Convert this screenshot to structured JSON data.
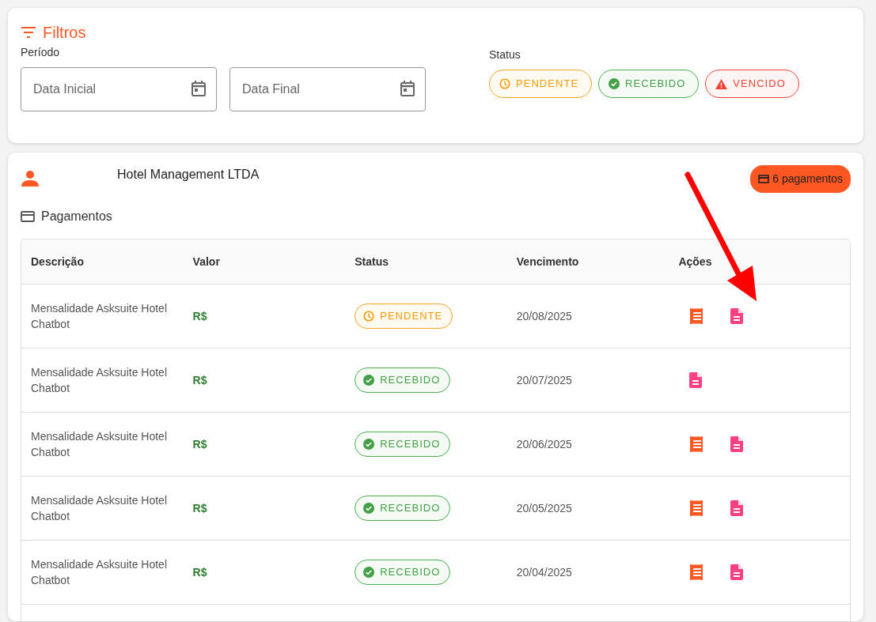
{
  "filters": {
    "title": "Filtros",
    "period_label": "Período",
    "date_fields": [
      {
        "placeholder": "Data Inicial"
      },
      {
        "placeholder": "Data Final"
      }
    ],
    "status_label": "Status",
    "status_chips": [
      {
        "kind": "pendente",
        "label": "PENDENTE"
      },
      {
        "kind": "recebido",
        "label": "RECEBIDO"
      },
      {
        "kind": "vencido",
        "label": "VENCIDO"
      }
    ]
  },
  "client": {
    "name": "Hotel Management LTDA",
    "payments_badge": "6 pagamentos",
    "section_title": "Pagamentos",
    "table": {
      "columns": [
        "Descrição",
        "Valor",
        "Status",
        "Vencimento",
        "Ações"
      ],
      "rows": [
        {
          "description": "Mensalidade Asksuite Hotel Chatbot",
          "value": "R$",
          "status": {
            "kind": "pendente",
            "label": "PENDENTE"
          },
          "due": "20/08/2025",
          "receipt": true,
          "document": true
        },
        {
          "description": "Mensalidade Asksuite Hotel Chatbot",
          "value": "R$",
          "status": {
            "kind": "recebido",
            "label": "RECEBIDO"
          },
          "due": "20/07/2025",
          "receipt": false,
          "document": true
        },
        {
          "description": "Mensalidade Asksuite Hotel Chatbot",
          "value": "R$",
          "status": {
            "kind": "recebido",
            "label": "RECEBIDO"
          },
          "due": "20/06/2025",
          "receipt": true,
          "document": true
        },
        {
          "description": "Mensalidade Asksuite Hotel Chatbot",
          "value": "R$",
          "status": {
            "kind": "recebido",
            "label": "RECEBIDO"
          },
          "due": "20/05/2025",
          "receipt": true,
          "document": true
        },
        {
          "description": "Mensalidade Asksuite Hotel Chatbot",
          "value": "R$",
          "status": {
            "kind": "recebido",
            "label": "RECEBIDO"
          },
          "due": "20/04/2025",
          "receipt": true,
          "document": true
        }
      ]
    }
  }
}
